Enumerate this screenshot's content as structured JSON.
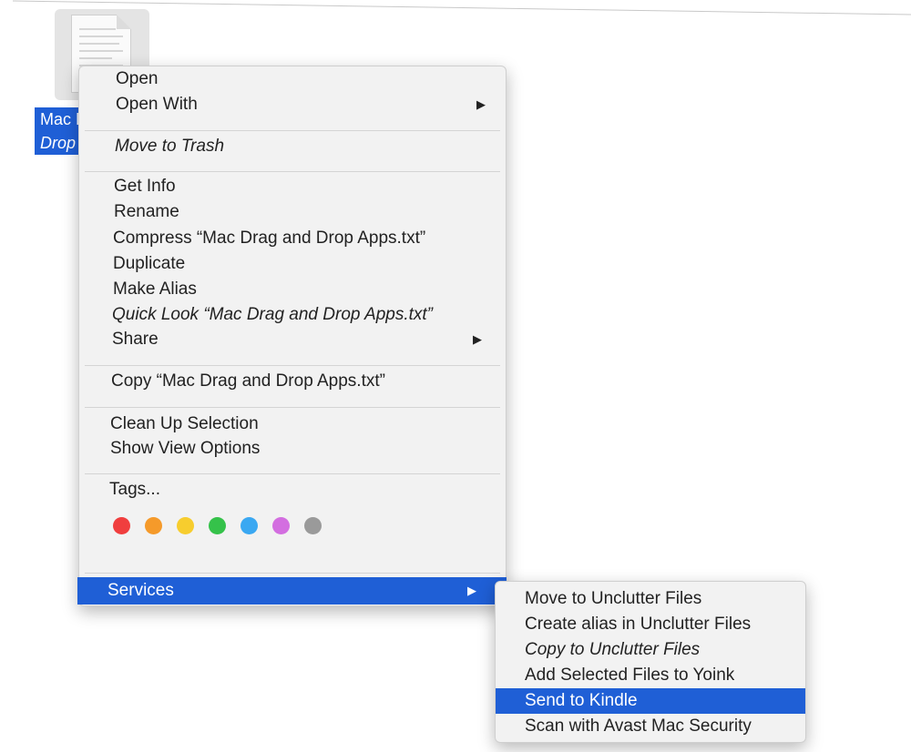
{
  "file": {
    "label_line1": "Mac D",
    "label_line2": "Drop"
  },
  "context_menu": {
    "open": "Open",
    "open_with": "Open With",
    "move_to_trash": "Move to Trash",
    "get_info": "Get Info",
    "rename": "Rename",
    "compress": "Compress “Mac Drag and Drop Apps.txt”",
    "duplicate": "Duplicate",
    "make_alias": "Make Alias",
    "quick_look": "Quick Look “Mac Drag and Drop Apps.txt”",
    "share": "Share",
    "copy": "Copy “Mac Drag and Drop Apps.txt”",
    "clean_up": "Clean Up Selection",
    "show_view_options": "Show View Options",
    "tags": "Tags...",
    "services": "Services",
    "submenu_arrow": "▶"
  },
  "tag_colors": [
    "#f03e3e",
    "#f59a2a",
    "#f7cd2e",
    "#35c24a",
    "#3aa8f2",
    "#d36ee0",
    "#9a9a9a"
  ],
  "services_menu": {
    "items": [
      "Move to Unclutter Files",
      "Create alias in Unclutter Files",
      "Copy to Unclutter Files",
      "Add Selected Files to Yoink",
      "Send to Kindle",
      "Scan with Avast Mac Security"
    ],
    "selected_index": 4
  },
  "colors": {
    "selection": "#1f5fd6",
    "menu_background": "#f2f2f2"
  }
}
